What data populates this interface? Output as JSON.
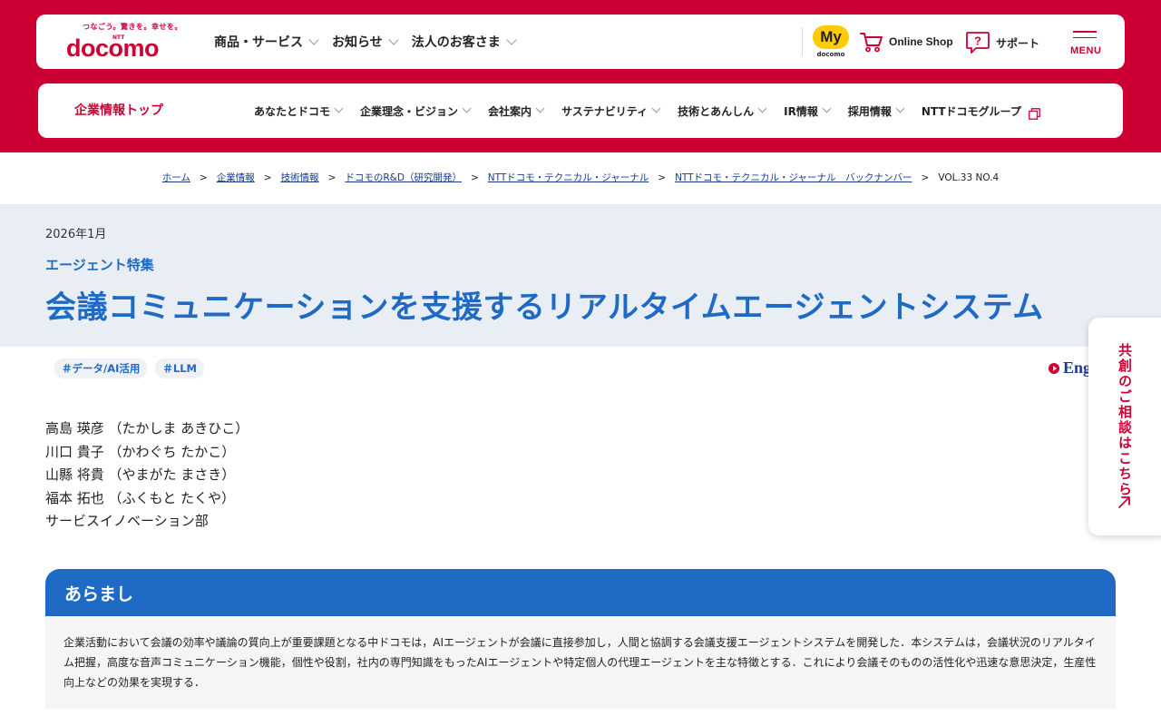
{
  "header": {
    "logo_tagline": "つなごう。驚きを。幸せを。",
    "logo_ntt": "NTT",
    "logo_text": "docomo",
    "nav": [
      {
        "label": "商品・サービス"
      },
      {
        "label": "お知らせ"
      },
      {
        "label": "法人のお客さま"
      }
    ],
    "my_label": "My",
    "my_sub": "docomo",
    "online_shop": "Online Shop",
    "support": "サポート",
    "menu": "MENU"
  },
  "subheader": {
    "top_link": "企業情報トップ",
    "nav": [
      {
        "label": "あなたとドコモ"
      },
      {
        "label": "企業理念・ビジョン"
      },
      {
        "label": "会社案内"
      },
      {
        "label": "サステナビリティ"
      },
      {
        "label": "技術とあんしん"
      },
      {
        "label": "IR情報"
      },
      {
        "label": "採用情報"
      },
      {
        "label": "NTTドコモグループ"
      }
    ]
  },
  "breadcrumb": {
    "items": [
      "ホーム",
      "企業情報",
      "技術情報",
      "ドコモのR&D（研究開発）",
      "NTTドコモ・テクニカル・ジャーナル",
      "NTTドコモ・テクニカル・ジャーナル　バックナンバー"
    ],
    "separator": ">",
    "current": "VOL.33 NO.4"
  },
  "article": {
    "date": "2026年1月",
    "series": "エージェント特集",
    "title": "会議コミュニケーションを支援するリアルタイムエージェントシステム",
    "tags": [
      "＃データ/AI活用",
      "＃LLM"
    ],
    "english_link": "Eng",
    "authors": [
      "高島 瑛彦 （たかしま あきひこ）",
      "川口 貴子 （かわぐち たかこ）",
      "山縣 将貴 （やまがた まさき）",
      "福本 拓也 （ふくもと たくや）",
      "サービスイノベーション部"
    ],
    "abstract_heading": "あらまし",
    "abstract_text": "企業活動において会議の効率や議論の質向上が重要課題となる中ドコモは，AIエージェントが会議に直接参加し，人間と協調する会議支援エージェントシステムを開発した．本システムは，会議状況のリアルタイム把握，高度な音声コミュニケーション機能，個性や役割，社内の専門知識をもったAIエージェントや特定個人の代理エージェントを主な特徴とする．これにより会議そのものの活性化や迅速な意思決定，生産性向上などの効果を実現する．"
  },
  "side_tab": {
    "label": "共創のご相談はこちら"
  },
  "colors": {
    "brand_red": "#cc0033",
    "accent_blue": "#1f6ac4",
    "link_blue": "#1a3c8a",
    "my_yellow": "#ffcc00"
  }
}
